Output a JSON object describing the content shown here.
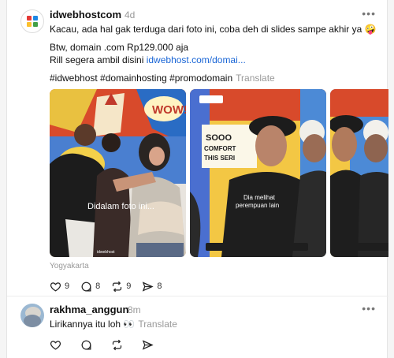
{
  "post": {
    "username": "idwebhostcom",
    "time_ago": "4d",
    "more_label": "•••",
    "line1": "Kacau, ada hal gak terduga dari foto ini, coba deh di slides sampe akhir ya 🤪",
    "line2": "Btw, domain .com Rp129.000 aja",
    "line3_prefix": "Rill segera ambil disini ",
    "line3_link": "idwebhost.com/domai...",
    "hashtags": "#idwebhost #domainhosting #promodomain",
    "translate": "Translate",
    "photos": [
      {
        "caption": "Didalam foto ini..."
      },
      {
        "caption_line1": "Dia melihat",
        "caption_line2": "perempuan lain"
      },
      {
        "caption": ""
      }
    ],
    "photo_brand": "idwebhost",
    "photo_sign": "SOOO COMFORT THIS SERI",
    "location": "Yogyakarta",
    "likes": "9",
    "comments": "8",
    "reposts": "9",
    "shares": "8"
  },
  "reply": {
    "username": "rakhma_anggun",
    "time_ago": "8m",
    "more_label": "•••",
    "text": "Lirikannya itu loh 👀",
    "translate": "Translate"
  },
  "colors": {
    "link": "#1a66d6",
    "logo_red": "#e53935",
    "logo_blue": "#1e88e5",
    "logo_yellow": "#fbc02d",
    "logo_green": "#43a047"
  },
  "icons": [
    "heart-icon",
    "comment-icon",
    "repost-icon",
    "share-icon",
    "more-icon"
  ]
}
